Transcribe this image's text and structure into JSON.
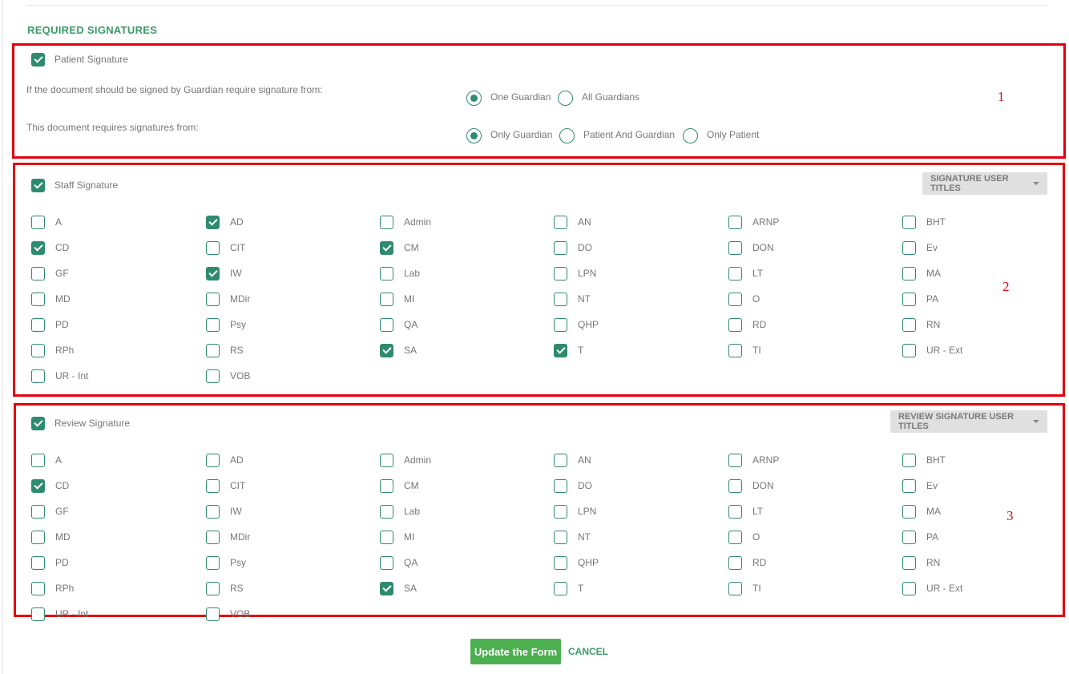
{
  "section_title": "REQUIRED SIGNATURES",
  "annotations": [
    "1",
    "2",
    "3"
  ],
  "patient": {
    "label": "Patient Signature",
    "checked": true,
    "guardian_question": "If the document should be signed by Guardian require signature from:",
    "guardian_options": [
      {
        "label": "One Guardian",
        "selected": true
      },
      {
        "label": "All Guardians",
        "selected": false
      }
    ],
    "requires_question": "This document requires signatures from:",
    "requires_options": [
      {
        "label": "Only Guardian",
        "selected": true
      },
      {
        "label": "Patient And Guardian",
        "selected": false
      },
      {
        "label": "Only Patient",
        "selected": false
      }
    ]
  },
  "staff": {
    "label": "Staff Signature",
    "checked": true,
    "dropdown_label": "SIGNATURE USER TITLES",
    "titles": [
      {
        "label": "A",
        "checked": false
      },
      {
        "label": "AD",
        "checked": true
      },
      {
        "label": "Admin",
        "checked": false
      },
      {
        "label": "AN",
        "checked": false
      },
      {
        "label": "ARNP",
        "checked": false
      },
      {
        "label": "BHT",
        "checked": false
      },
      {
        "label": "CD",
        "checked": true
      },
      {
        "label": "CIT",
        "checked": false
      },
      {
        "label": "CM",
        "checked": true
      },
      {
        "label": "DO",
        "checked": false
      },
      {
        "label": "DON",
        "checked": false
      },
      {
        "label": "Ev",
        "checked": false
      },
      {
        "label": "GF",
        "checked": false
      },
      {
        "label": "IW",
        "checked": true
      },
      {
        "label": "Lab",
        "checked": false
      },
      {
        "label": "LPN",
        "checked": false
      },
      {
        "label": "LT",
        "checked": false
      },
      {
        "label": "MA",
        "checked": false
      },
      {
        "label": "MD",
        "checked": false
      },
      {
        "label": "MDir",
        "checked": false
      },
      {
        "label": "MI",
        "checked": false
      },
      {
        "label": "NT",
        "checked": false
      },
      {
        "label": "O",
        "checked": false
      },
      {
        "label": "PA",
        "checked": false
      },
      {
        "label": "PD",
        "checked": false
      },
      {
        "label": "Psy",
        "checked": false
      },
      {
        "label": "QA",
        "checked": false
      },
      {
        "label": "QHP",
        "checked": false
      },
      {
        "label": "RD",
        "checked": false
      },
      {
        "label": "RN",
        "checked": false
      },
      {
        "label": "RPh",
        "checked": false
      },
      {
        "label": "RS",
        "checked": false
      },
      {
        "label": "SA",
        "checked": true
      },
      {
        "label": "T",
        "checked": true
      },
      {
        "label": "TI",
        "checked": false
      },
      {
        "label": "UR - Ext",
        "checked": false
      },
      {
        "label": "UR - Int",
        "checked": false
      },
      {
        "label": "VOB",
        "checked": false
      }
    ]
  },
  "review": {
    "label": "Review Signature",
    "checked": true,
    "dropdown_label": "REVIEW SIGNATURE USER TITLES",
    "titles": [
      {
        "label": "A",
        "checked": false
      },
      {
        "label": "AD",
        "checked": false
      },
      {
        "label": "Admin",
        "checked": false
      },
      {
        "label": "AN",
        "checked": false
      },
      {
        "label": "ARNP",
        "checked": false
      },
      {
        "label": "BHT",
        "checked": false
      },
      {
        "label": "CD",
        "checked": true
      },
      {
        "label": "CIT",
        "checked": false
      },
      {
        "label": "CM",
        "checked": false
      },
      {
        "label": "DO",
        "checked": false
      },
      {
        "label": "DON",
        "checked": false
      },
      {
        "label": "Ev",
        "checked": false
      },
      {
        "label": "GF",
        "checked": false
      },
      {
        "label": "IW",
        "checked": false
      },
      {
        "label": "Lab",
        "checked": false
      },
      {
        "label": "LPN",
        "checked": false
      },
      {
        "label": "LT",
        "checked": false
      },
      {
        "label": "MA",
        "checked": false
      },
      {
        "label": "MD",
        "checked": false
      },
      {
        "label": "MDir",
        "checked": false
      },
      {
        "label": "MI",
        "checked": false
      },
      {
        "label": "NT",
        "checked": false
      },
      {
        "label": "O",
        "checked": false
      },
      {
        "label": "PA",
        "checked": false
      },
      {
        "label": "PD",
        "checked": false
      },
      {
        "label": "Psy",
        "checked": false
      },
      {
        "label": "QA",
        "checked": false
      },
      {
        "label": "QHP",
        "checked": false
      },
      {
        "label": "RD",
        "checked": false
      },
      {
        "label": "RN",
        "checked": false
      },
      {
        "label": "RPh",
        "checked": false
      },
      {
        "label": "RS",
        "checked": false
      },
      {
        "label": "SA",
        "checked": true
      },
      {
        "label": "T",
        "checked": false
      },
      {
        "label": "TI",
        "checked": false
      },
      {
        "label": "UR - Ext",
        "checked": false
      },
      {
        "label": "UR - Int",
        "checked": false
      },
      {
        "label": "VOB",
        "checked": false
      }
    ]
  },
  "actions": {
    "update_label": "Update the Form",
    "cancel_label": "CANCEL"
  }
}
